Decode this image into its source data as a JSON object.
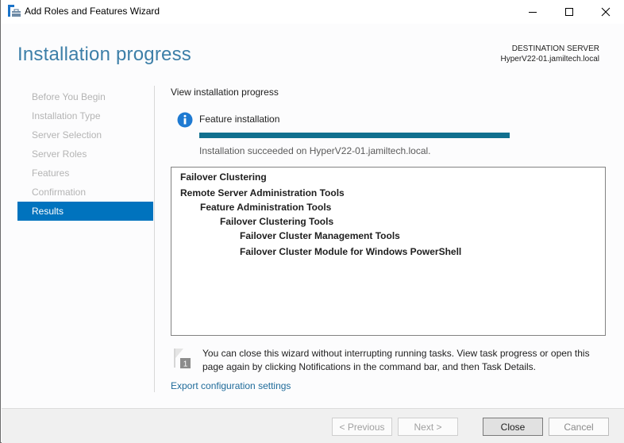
{
  "window": {
    "title": "Add Roles and Features Wizard",
    "icon": "server-manager-icon",
    "controls": {
      "minimize": "minimize-icon",
      "maximize": "maximize-icon",
      "close": "close-icon"
    }
  },
  "header": {
    "heading": "Installation progress",
    "destination_label": "DESTINATION SERVER",
    "destination_server": "HyperV22-01.jamiltech.local"
  },
  "nav": {
    "items": [
      {
        "label": "Before You Begin",
        "state": "disabled"
      },
      {
        "label": "Installation Type",
        "state": "disabled"
      },
      {
        "label": "Server Selection",
        "state": "disabled"
      },
      {
        "label": "Server Roles",
        "state": "disabled"
      },
      {
        "label": "Features",
        "state": "disabled"
      },
      {
        "label": "Confirmation",
        "state": "disabled"
      },
      {
        "label": "Results",
        "state": "active"
      }
    ]
  },
  "content": {
    "section_title": "View installation progress",
    "feature_label": "Feature installation",
    "progress_percent": 100,
    "status_text": "Installation succeeded on HyperV22-01.jamiltech.local.",
    "results": [
      {
        "text": "Failover Clustering",
        "level": 0
      },
      {
        "text": "Remote Server Administration Tools",
        "level": 0
      },
      {
        "text": "Feature Administration Tools",
        "level": 1
      },
      {
        "text": "Failover Clustering Tools",
        "level": 2
      },
      {
        "text": "Failover Cluster Management Tools",
        "level": 3
      },
      {
        "text": "Failover Cluster Module for Windows PowerShell",
        "level": 3
      }
    ],
    "notice_text": "You can close this wizard without interrupting running tasks. View task progress or open this page again by clicking Notifications in the command bar, and then Task Details.",
    "notice_badge": "1",
    "export_link": "Export configuration settings"
  },
  "footer": {
    "previous_label": "< Previous",
    "next_label": "Next >",
    "close_label": "Close",
    "cancel_label": "Cancel"
  },
  "colors": {
    "accent": "#0073be",
    "heading": "#3d7fa8",
    "progress": "#11708f",
    "link": "#1f6b9a"
  }
}
